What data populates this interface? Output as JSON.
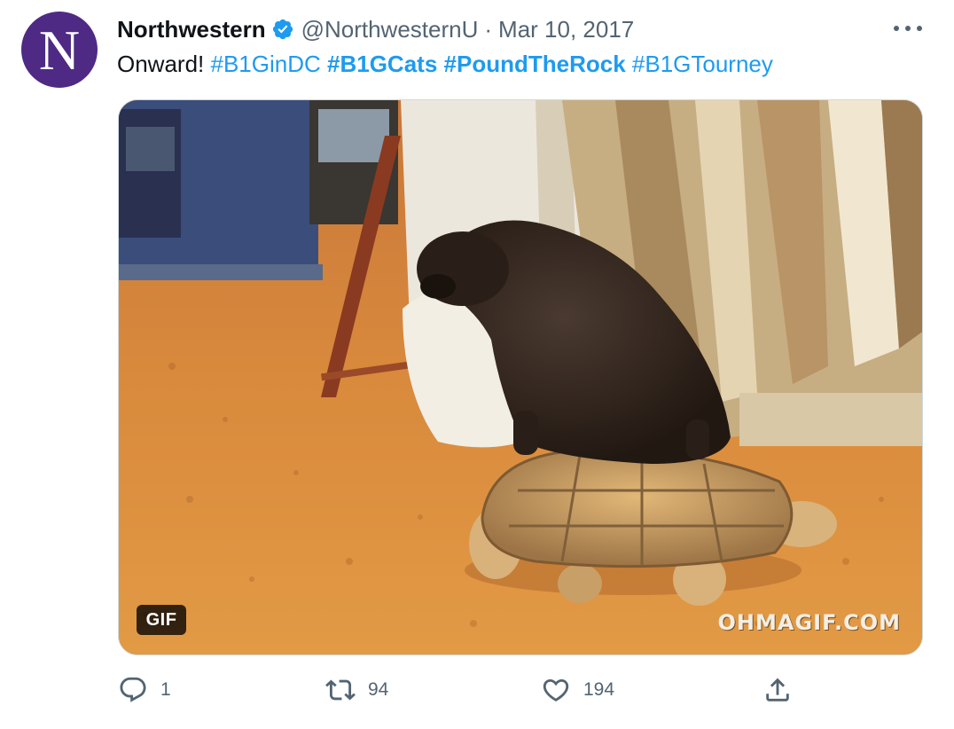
{
  "author": {
    "avatar_letter": "N",
    "avatar_color": "#4e2a84",
    "display_name": "Northwestern",
    "verified_icon": "verified-badge-icon",
    "handle": "@NorthwesternU",
    "separator": "·",
    "date": "Mar 10, 2017"
  },
  "tweet": {
    "text_prefix": "Onward!",
    "hashtags": [
      "#B1GinDC",
      "#B1GCats",
      "#PoundTheRock",
      "#B1GTourney"
    ],
    "hashtag_color": "#1d9bf0"
  },
  "media": {
    "badge": "GIF",
    "watermark": "OHMAGIF.COM"
  },
  "actions": {
    "reply_count": "1",
    "retweet_count": "94",
    "like_count": "194",
    "icons": [
      "reply-icon",
      "retweet-icon",
      "like-icon",
      "share-icon"
    ]
  }
}
